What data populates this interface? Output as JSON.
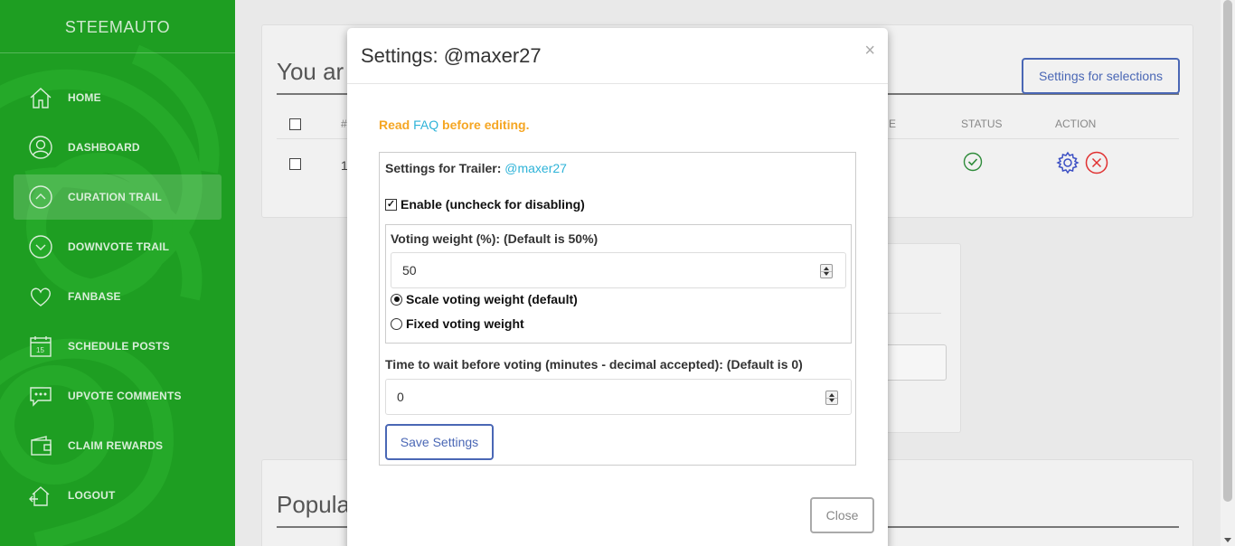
{
  "sidebar": {
    "brand": "STEEMAUTO",
    "items": [
      {
        "label": "HOME",
        "icon": "home-icon"
      },
      {
        "label": "DASHBOARD",
        "icon": "user-icon"
      },
      {
        "label": "CURATION TRAIL",
        "icon": "chevron-up-icon",
        "active": true
      },
      {
        "label": "DOWNVOTE TRAIL",
        "icon": "chevron-down-icon"
      },
      {
        "label": "FANBASE",
        "icon": "heart-icon"
      },
      {
        "label": "SCHEDULE POSTS",
        "icon": "calendar-icon",
        "calendar_day": "15"
      },
      {
        "label": "UPVOTE COMMENTS",
        "icon": "comment-icon"
      },
      {
        "label": "CLAIM REWARDS",
        "icon": "wallet-icon"
      },
      {
        "label": "LOGOUT",
        "icon": "logout-icon"
      }
    ]
  },
  "background": {
    "card1_title": "You ar",
    "settings_selections_label": "Settings for selections",
    "table_headers": {
      "hash": "#",
      "e_col": "E",
      "status": "STATUS",
      "action": "ACTION"
    },
    "row_number": "1",
    "card3_title": "Popula"
  },
  "modal": {
    "title": "Settings: @maxer27",
    "close_x": "×",
    "faq_prefix": "Read ",
    "faq_link": "FAQ",
    "faq_suffix": " before editing.",
    "trailer_label": "Settings for Trailer: ",
    "trailer_name": "@maxer27",
    "enable_label": "Enable (uncheck for disabling)",
    "enable_checked": true,
    "voting_weight_label": "Voting weight (%): (Default is 50%)",
    "voting_weight_value": "50",
    "radio_scale": "Scale voting weight (default)",
    "radio_fixed": "Fixed voting weight",
    "wait_label": "Time to wait before voting (minutes - decimal accepted): (Default is 0)",
    "wait_value": "0",
    "save_label": "Save Settings",
    "close_label": "Close"
  },
  "colors": {
    "sidebar_green": "#1e9e22",
    "accent_blue": "#4a67b5",
    "faq_orange": "#f5a623",
    "link_cyan": "#2eb3d8",
    "status_green": "#2e8b3a",
    "danger_red": "#e03030"
  }
}
